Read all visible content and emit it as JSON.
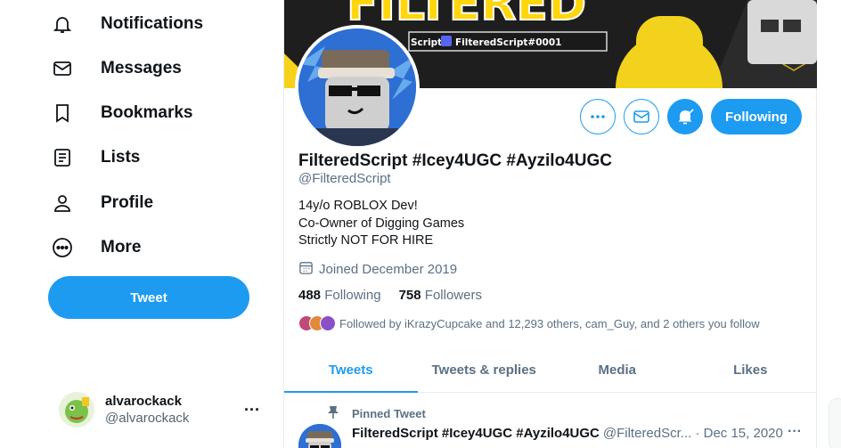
{
  "nav": {
    "items": [
      {
        "label": "Notifications",
        "icon": "bell-icon"
      },
      {
        "label": "Messages",
        "icon": "envelope-icon"
      },
      {
        "label": "Bookmarks",
        "icon": "bookmark-icon"
      },
      {
        "label": "Lists",
        "icon": "list-icon"
      },
      {
        "label": "Profile",
        "icon": "person-icon"
      },
      {
        "label": "More",
        "icon": "more-circle-icon"
      }
    ],
    "tweet_label": "Tweet"
  },
  "account": {
    "name": "alvarockack",
    "handle": "@alvarockack",
    "more": "···"
  },
  "banner": {
    "text_big": "FILTERED",
    "text_small_1": "Script",
    "text_small_2": "FilteredScript#0001"
  },
  "profile": {
    "display_name": "FilteredScript #Icey4UGC #Ayzilo4UGC",
    "screen_name": "@FilteredScript",
    "bio": [
      "14y/o ROBLOX Dev!",
      "Co-Owner of Digging Games",
      "Strictly NOT FOR HIRE"
    ],
    "joined": "Joined December 2019",
    "following_count": "488",
    "following_label": "Following",
    "followers_count": "758",
    "followers_label": "Followers",
    "followed_by": "Followed by iKrazyCupcake and 12,293 others, cam_Guy, and 2 others you follow",
    "following_button": "Following",
    "more_dots": "···"
  },
  "tabs": [
    "Tweets",
    "Tweets & replies",
    "Media",
    "Likes"
  ],
  "pinned": {
    "label": "Pinned Tweet",
    "name": "FilteredScript #Icey4UGC #Ayzilo4UGC",
    "handle_date": "@FilteredScr... · Dec 15, 2020",
    "more": "···"
  },
  "colors": {
    "accent": "#1d9bf0",
    "text": "#0f1419",
    "muted": "#5b7083"
  }
}
